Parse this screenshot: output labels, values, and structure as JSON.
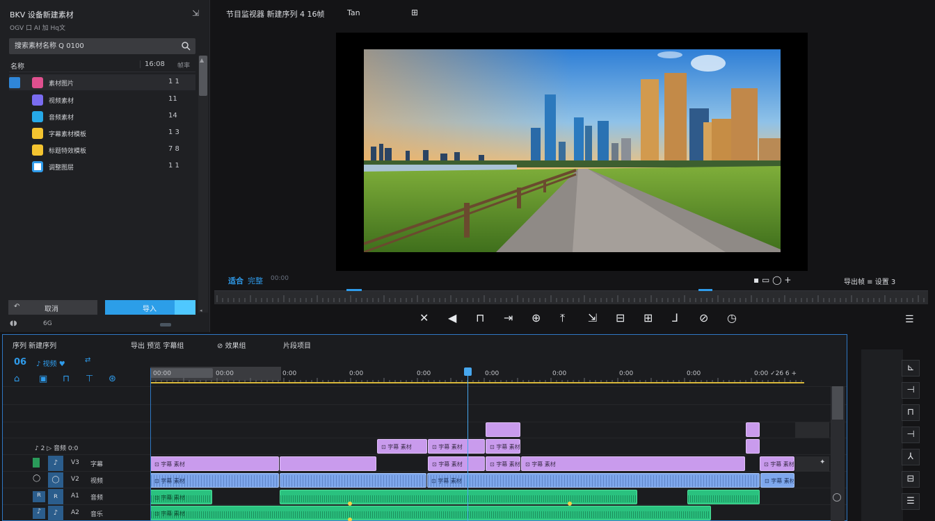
{
  "project": {
    "title": "BKV 设备新建素材",
    "subtitle": "OGV 口 AI 加 Hq文",
    "search_placeholder": "搜索素材名称 Q 0100",
    "columns": {
      "name": "名称",
      "duration": "16:08",
      "extra": "帧率"
    },
    "files": [
      {
        "name": "素材图片",
        "count": "1 1",
        "color": "#e0508f"
      },
      {
        "name": "视频素材",
        "count": "11",
        "color": "#7a6cf0"
      },
      {
        "name": "音频素材",
        "count": "14",
        "color": "#26a9e8"
      },
      {
        "name": "字幕素材模板",
        "count": "1 3",
        "color": "#f4c430"
      },
      {
        "name": "标题特效模板",
        "count": "7 8",
        "color": "#f4c430"
      },
      {
        "name": "调整图层",
        "count": "1 1",
        "color": "#2f9bea"
      }
    ],
    "btn_left": "取消",
    "btn_right": "导入",
    "footer_text": "6G"
  },
  "monitor": {
    "tab1": "节目监视器 新建序列 4 16帧",
    "tab2": "Tan",
    "tab3": "⊞",
    "left_label": "适合",
    "left_label2": "完整",
    "left_tc": "00:00",
    "right_label": "导出帧 ≡ 设置 3 ",
    "right_controls": "▪ ▭  ◯ +"
  },
  "timeline": {
    "tabs": [
      "序列 新建序列",
      "导出 预览 字幕组",
      "⊘ 效果组",
      "片段项目"
    ],
    "timecode": "06",
    "timecode_suffix": "♪ 视频 ♥",
    "timecode_extra": "⇄",
    "ruler_labels": [
      "00:00",
      "00:00",
      "0:00",
      "0:00",
      "0:00",
      "0:00",
      "0:00",
      "0:00",
      "0:00",
      "0:00 ✓26 6 +"
    ],
    "track_label_row": "♪ 2 ▷ 音频 0:0",
    "tracks": [
      {
        "l1": "V3",
        "l2": "字幕",
        "icon": "♪"
      },
      {
        "l1": "V2",
        "l2": "视频",
        "icon": "◯"
      },
      {
        "l1": "A1",
        "l2": "音频",
        "icon": "ʀ"
      },
      {
        "l1": "A2",
        "l2": "音乐",
        "icon": "♪"
      }
    ],
    "clip_label": "⊡ 字幕 素材"
  },
  "colors": {
    "accent": "#2f9bea",
    "pink_clip": "#c99bed",
    "blue_clip": "#7ea7ec",
    "green_clip": "#2ac27f",
    "ruler_yellow": "#d9b83a"
  }
}
